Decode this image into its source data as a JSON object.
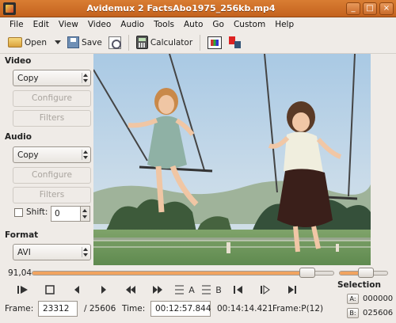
{
  "window": {
    "title": "Avidemux 2 FactsAbo1975_256kb.mp4",
    "controls": {
      "minimize": "_",
      "maximize": "□",
      "close": "×"
    }
  },
  "menu": [
    {
      "label": "File"
    },
    {
      "label": "Edit"
    },
    {
      "label": "View"
    },
    {
      "label": "Video"
    },
    {
      "label": "Audio"
    },
    {
      "label": "Tools"
    },
    {
      "label": "Auto"
    },
    {
      "label": "Go"
    },
    {
      "label": "Custom"
    },
    {
      "label": "Help"
    }
  ],
  "toolbar": {
    "open_label": "Open",
    "save_label": "Save",
    "calculator_label": "Calculator"
  },
  "left_panel": {
    "video": {
      "heading": "Video",
      "codec": "Copy",
      "configure_label": "Configure",
      "filters_label": "Filters"
    },
    "audio": {
      "heading": "Audio",
      "codec": "Copy",
      "configure_label": "Configure",
      "filters_label": "Filters",
      "shift_label": "Shift:",
      "shift_value": "0"
    },
    "format": {
      "heading": "Format",
      "container": "AVI"
    }
  },
  "slider": {
    "percent_label": "91,04",
    "position": 0.9104,
    "volume_level": 0.55
  },
  "transport": {
    "buttons": [
      "play",
      "stop",
      "prev-frame",
      "next-frame",
      "prev-keyframe",
      "next-keyframe",
      "set-marker-a",
      "set-marker-b",
      "go-start",
      "go-marker-a",
      "go-marker-b"
    ],
    "marker_a": "A",
    "marker_b": "B"
  },
  "selection": {
    "heading": "Selection",
    "a_label": "A:",
    "a_value": "000000",
    "b_label": "B:",
    "b_value": "025606"
  },
  "info": {
    "frame_label": "Frame:",
    "frame_value": "23312",
    "total_frames": "/ 25606",
    "time_label": "Time:",
    "time_value": "00:12:57.844",
    "duration": "00:14:14.421",
    "frame_type": "Frame:P(12)"
  },
  "colors": {
    "titlebar": "#c96b2a",
    "progress_fill": "#f1a460"
  }
}
